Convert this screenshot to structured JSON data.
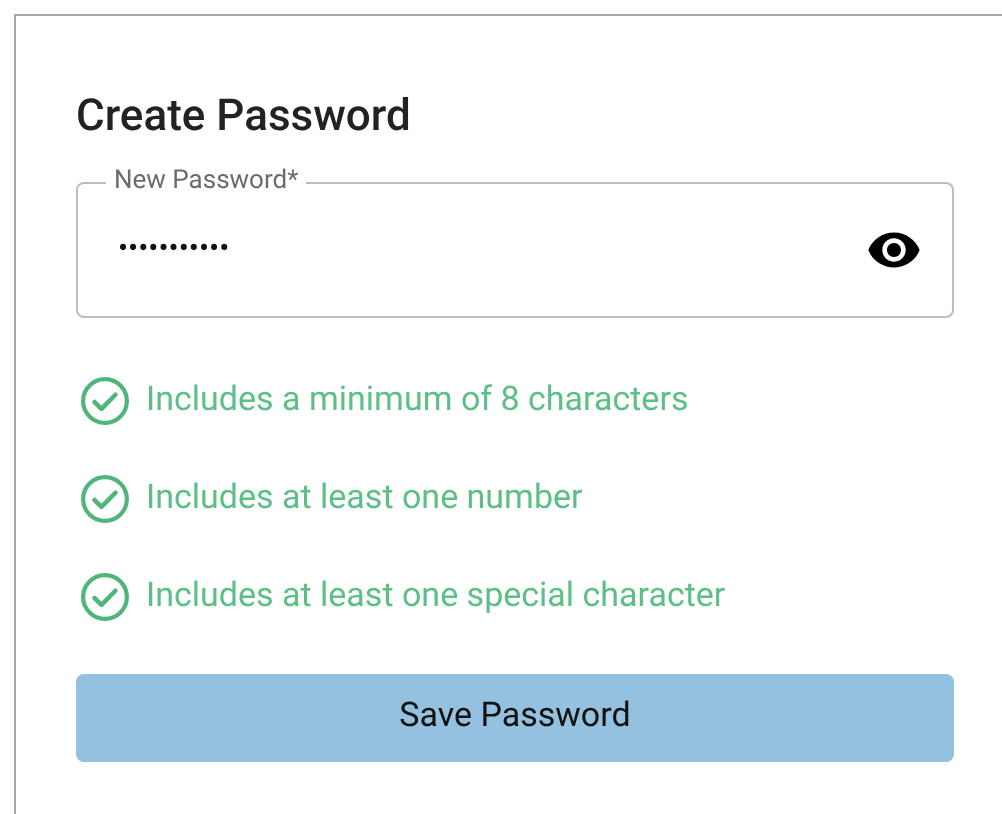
{
  "title": "Create Password",
  "password_field": {
    "label": "New Password*",
    "value": "•••••••••••",
    "visible": false
  },
  "requirements": [
    {
      "text": "Includes a minimum of 8 characters",
      "met": true
    },
    {
      "text": "Includes at least one number",
      "met": true
    },
    {
      "text": "Includes at least one special character",
      "met": true
    }
  ],
  "save_button": {
    "label": "Save Password",
    "disabled": true
  }
}
